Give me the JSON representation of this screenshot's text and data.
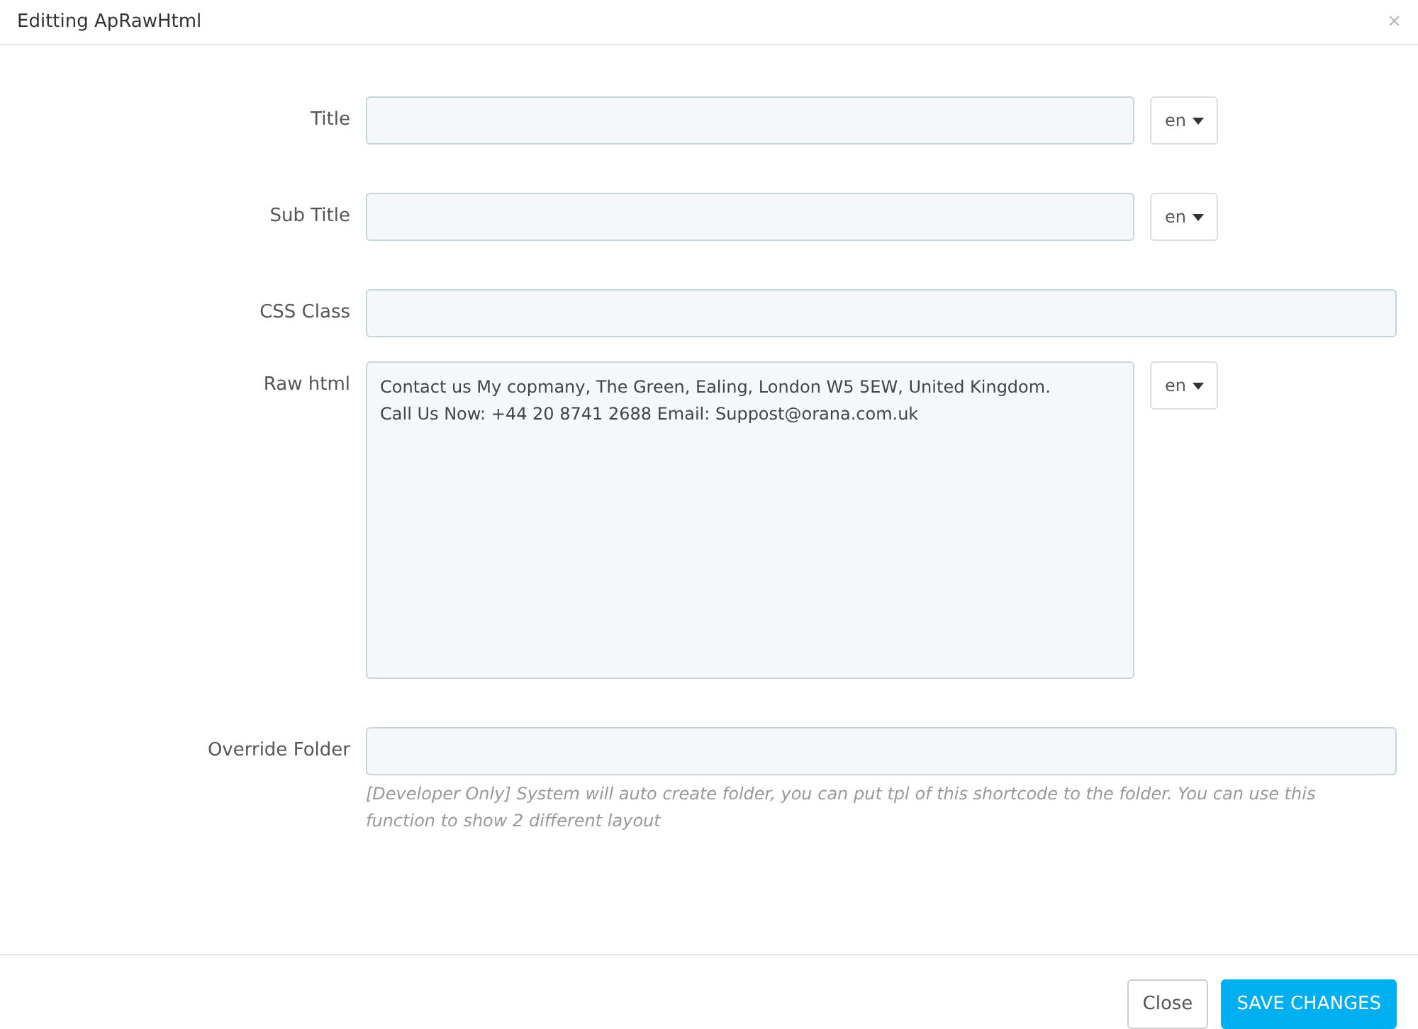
{
  "window": {
    "title": "Editting ApRawHtml",
    "close": "×"
  },
  "fields": [
    {
      "kind": "input",
      "label": "Title",
      "lang": "en"
    },
    {
      "kind": "input",
      "label": "Sub Title",
      "lang": "en"
    },
    {
      "kind": "input",
      "label": "CSS Class"
    },
    {
      "kind": "textarea",
      "label": "Raw html",
      "value": "Contact us My copmany, The Green, Ealing, London W5 5EW, United Kingdom.\nCall Us Now: +44 20 8741 2688 Email: Suppost@orana.com.uk",
      "lang": "en"
    },
    {
      "kind": "input",
      "label": "Override Folder",
      "help": "[Developer Only] System will auto create folder, you can put tpl of this shortcode to the folder. You can use this function to show 2 different layout"
    }
  ],
  "buttons": [
    {
      "label": "Close",
      "kind": "default"
    },
    {
      "label": "SAVE CHANGES",
      "kind": "primary"
    }
  ]
}
